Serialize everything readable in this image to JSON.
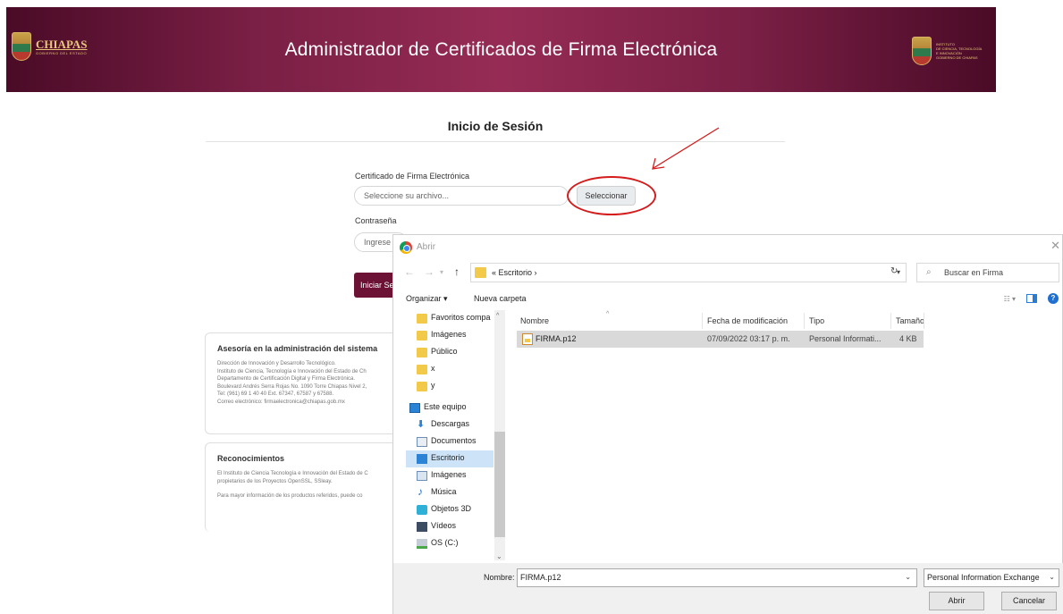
{
  "header": {
    "title": "Administrador de Certificados de Firma Electrónica",
    "logo_left": "CHIAPAS",
    "logo_left_sub": "GOBIERNO DEL ESTADO",
    "logo_right_lines": [
      "INSTITUTO",
      "DE CIENCIA, TECNOLOGÍA",
      "E INNOVACIÓN",
      "GOBIERNO DE CHIAPAS"
    ]
  },
  "login": {
    "title": "Inicio de Sesión",
    "cert_label": "Certificado de Firma Electrónica",
    "cert_placeholder": "Seleccione su archivo...",
    "select_button": "Seleccionar",
    "password_label": "Contraseña",
    "password_placeholder": "Ingrese l",
    "login_button": "Iniciar Se"
  },
  "advisory": {
    "title": "Asesoría en la administración del sistema",
    "lines": [
      "Dirección de Innovación y Desarrollo Tecnológico.",
      "Instituto de Ciencia, Tecnología e Innovación del Estado de Ch",
      "Departamento de Certificación Digital y Firma Electrónica.",
      "Boulevard Andrés Serra Rojas No. 1090 Torre Chiapas Nivel 2,",
      "Tel: (961) 69 1 40 40 Ext. 67347, 67587 y 67588.",
      "Correo electrónico: firmaelectronica@chiapas.gob.mx"
    ]
  },
  "acknowledgements": {
    "title": "Reconocimientos",
    "lines": [
      "El Instituto de Ciencia Tecnología e Innovación del Estado de C",
      "propietarios de los Proyectos OpenSSL, SSleay.",
      "",
      "Para mayor información de los productos referidos, puede co"
    ]
  },
  "dialog": {
    "title": "Abrir",
    "close": "✕",
    "path": "« Escritorio ›",
    "search_placeholder": "Buscar en Firma",
    "organize": "Organizar ▾",
    "new_folder": "Nueva carpeta",
    "nav_items": [
      {
        "label": "Favoritos compa",
        "icon": "folder"
      },
      {
        "label": "Imágenes",
        "icon": "folder"
      },
      {
        "label": "Público",
        "icon": "folder"
      },
      {
        "label": "x",
        "icon": "folder"
      },
      {
        "label": "y",
        "icon": "folder"
      },
      {
        "label": "Este equipo",
        "icon": "pc"
      },
      {
        "label": "Descargas",
        "icon": "download"
      },
      {
        "label": "Documentos",
        "icon": "documents"
      },
      {
        "label": "Escritorio",
        "icon": "desktop",
        "selected": true
      },
      {
        "label": "Imágenes",
        "icon": "pictures"
      },
      {
        "label": "Música",
        "icon": "music"
      },
      {
        "label": "Objetos 3D",
        "icon": "3d-objects"
      },
      {
        "label": "Vídeos",
        "icon": "videos"
      },
      {
        "label": "OS (C:)",
        "icon": "drive"
      }
    ],
    "columns": [
      "Nombre",
      "Fecha de modificación",
      "Tipo",
      "Tamaño"
    ],
    "files": [
      {
        "name": "FIRMA.p12",
        "modified": "07/09/2022 03:17 p. m.",
        "type": "Personal Informati...",
        "size": "4 KB"
      }
    ],
    "name_label": "Nombre:",
    "name_value": "FIRMA.p12",
    "file_type": "Personal Information Exchange",
    "open_button": "Abrir",
    "cancel_button": "Cancelar"
  },
  "colors": {
    "brand": "#6b1235",
    "annotation": "#d41c1c",
    "selection": "#cde3f7"
  }
}
